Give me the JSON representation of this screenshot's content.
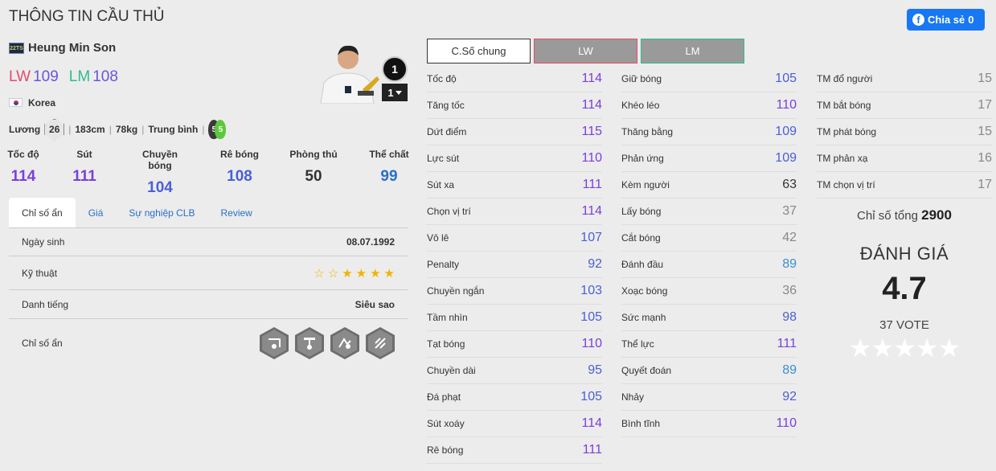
{
  "header": {
    "title": "THÔNG TIN CẦU THỦ",
    "share_label": "Chia sẻ",
    "share_count": "0"
  },
  "player": {
    "season": "22TS",
    "name": "Heung Min Son",
    "positions": [
      {
        "pos": "LW",
        "val": "109"
      },
      {
        "pos": "LM",
        "val": "108"
      }
    ],
    "nation": "Korea",
    "salary_label": "Lương",
    "salary": "26",
    "height": "183cm",
    "weight": "78kg",
    "body": "Trung bình",
    "left_foot": "5",
    "right_foot": "5",
    "ovr_badge": "1",
    "level": "1"
  },
  "main_stats": [
    {
      "label": "Tốc độ",
      "value": "114",
      "color": "#7a3fdc"
    },
    {
      "label": "Sút",
      "value": "111",
      "color": "#7a3fdc"
    },
    {
      "label": "Chuyền bóng",
      "value": "104",
      "color": "#4a5fd6"
    },
    {
      "label": "Rê bóng",
      "value": "108",
      "color": "#4a5fd6"
    },
    {
      "label": "Phòng thủ",
      "value": "50",
      "color": "#333333"
    },
    {
      "label": "Thể chất",
      "value": "99",
      "color": "#2a6fc4"
    }
  ],
  "tabs": [
    "Chỉ số ẩn",
    "Giá",
    "Sự nghiệp CLB",
    "Review"
  ],
  "details": {
    "birth_label": "Ngày sinh",
    "birth": "08.07.1992",
    "skill_label": "Kỹ thuật",
    "skill_stars": 4,
    "rep_label": "Danh tiếng",
    "rep": "Siêu sao",
    "hidden_label": "Chỉ số ẩn",
    "trait_icons": [
      "long-shot-taker-icon",
      "power-header-icon",
      "finesse-shot-icon",
      "speed-dribbler-icon"
    ]
  },
  "position_tabs": [
    "C.Số chung",
    "LW",
    "LM"
  ],
  "stats_col1": [
    {
      "name": "Tốc độ",
      "val": "114",
      "color": "#7a3fdc"
    },
    {
      "name": "Tăng tốc",
      "val": "114",
      "color": "#7a3fdc"
    },
    {
      "name": "Dứt điểm",
      "val": "115",
      "color": "#7a3fdc"
    },
    {
      "name": "Lực sút",
      "val": "110",
      "color": "#7a3fdc"
    },
    {
      "name": "Sút xa",
      "val": "111",
      "color": "#7a3fdc"
    },
    {
      "name": "Chọn vị trí",
      "val": "114",
      "color": "#7a3fdc"
    },
    {
      "name": "Vô lê",
      "val": "107",
      "color": "#4a5fd6"
    },
    {
      "name": "Penalty",
      "val": "92",
      "color": "#4a5fd6"
    },
    {
      "name": "Chuyền ngắn",
      "val": "103",
      "color": "#4a5fd6"
    },
    {
      "name": "Tầm nhìn",
      "val": "105",
      "color": "#4a5fd6"
    },
    {
      "name": "Tạt bóng",
      "val": "110",
      "color": "#7a3fdc"
    },
    {
      "name": "Chuyền dài",
      "val": "95",
      "color": "#4a5fd6"
    },
    {
      "name": "Đá phạt",
      "val": "105",
      "color": "#4a5fd6"
    },
    {
      "name": "Sút xoáy",
      "val": "114",
      "color": "#7a3fdc"
    },
    {
      "name": "Rê bóng",
      "val": "111",
      "color": "#7a3fdc"
    }
  ],
  "stats_col2": [
    {
      "name": "Giữ bóng",
      "val": "105",
      "color": "#4a5fd6"
    },
    {
      "name": "Khéo léo",
      "val": "110",
      "color": "#7a3fdc"
    },
    {
      "name": "Thăng bằng",
      "val": "109",
      "color": "#4a5fd6"
    },
    {
      "name": "Phản ứng",
      "val": "109",
      "color": "#4a5fd6"
    },
    {
      "name": "Kèm người",
      "val": "63",
      "color": "#333333"
    },
    {
      "name": "Lấy bóng",
      "val": "37",
      "color": "#888888"
    },
    {
      "name": "Cắt bóng",
      "val": "42",
      "color": "#888888"
    },
    {
      "name": "Đánh đầu",
      "val": "89",
      "color": "#3a8fd0"
    },
    {
      "name": "Xoạc bóng",
      "val": "36",
      "color": "#888888"
    },
    {
      "name": "Sức mạnh",
      "val": "98",
      "color": "#4a5fd6"
    },
    {
      "name": "Thể lực",
      "val": "111",
      "color": "#7a3fdc"
    },
    {
      "name": "Quyết đoán",
      "val": "89",
      "color": "#3a8fd0"
    },
    {
      "name": "Nhảy",
      "val": "92",
      "color": "#4a5fd6"
    },
    {
      "name": "Bình tĩnh",
      "val": "110",
      "color": "#7a3fdc"
    }
  ],
  "stats_col3": [
    {
      "name": "TM đổ người",
      "val": "15",
      "color": "#888888"
    },
    {
      "name": "TM bắt bóng",
      "val": "17",
      "color": "#888888"
    },
    {
      "name": "TM phát bóng",
      "val": "15",
      "color": "#888888"
    },
    {
      "name": "TM phản xạ",
      "val": "16",
      "color": "#888888"
    },
    {
      "name": "TM chọn vị trí",
      "val": "17",
      "color": "#888888"
    }
  ],
  "summary": {
    "total_label": "Chỉ số tổng",
    "total": "2900",
    "rating_title": "ĐÁNH GIÁ",
    "rating": "4.7",
    "votes": "37 VOTE",
    "stars": "★★★★★"
  }
}
